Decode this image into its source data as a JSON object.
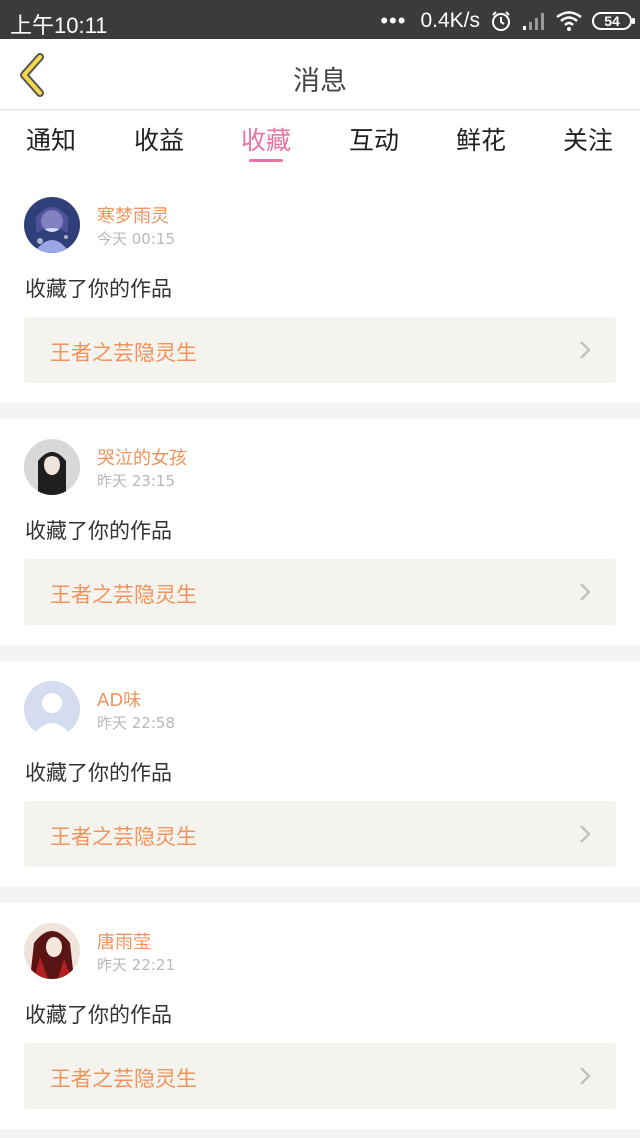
{
  "status_bar": {
    "time": "上午10:11",
    "dots": "•••",
    "speed": "0.4K/s",
    "battery": "54",
    "icons": [
      "alarm-icon",
      "signal-icon",
      "wifi-icon",
      "battery-icon"
    ]
  },
  "header": {
    "title": "消息",
    "back_icon": "chevron-left-icon",
    "accent": "#f5d94a"
  },
  "tabs": [
    {
      "label": "通知",
      "active": false
    },
    {
      "label": "收益",
      "active": false
    },
    {
      "label": "收藏",
      "active": true
    },
    {
      "label": "互动",
      "active": false
    },
    {
      "label": "鲜花",
      "active": false
    },
    {
      "label": "关注",
      "active": false
    }
  ],
  "messages": [
    {
      "user": "寒梦雨灵",
      "time": "今天 00:15",
      "action": "收藏了你的作品",
      "work": "王者之芸隐灵生"
    },
    {
      "user": "哭泣的女孩",
      "time": "昨天 23:15",
      "action": "收藏了你的作品",
      "work": "王者之芸隐灵生"
    },
    {
      "user": "AD味",
      "time": "昨天 22:58",
      "action": "收藏了你的作品",
      "work": "王者之芸隐灵生"
    },
    {
      "user": "唐雨莹",
      "time": "昨天 22:21",
      "action": "收藏了你的作品",
      "work": "王者之芸隐灵生"
    }
  ],
  "colors": {
    "active_tab": "#e874a6",
    "name": "#f0935c",
    "work_bg": "#f4f3ed"
  }
}
